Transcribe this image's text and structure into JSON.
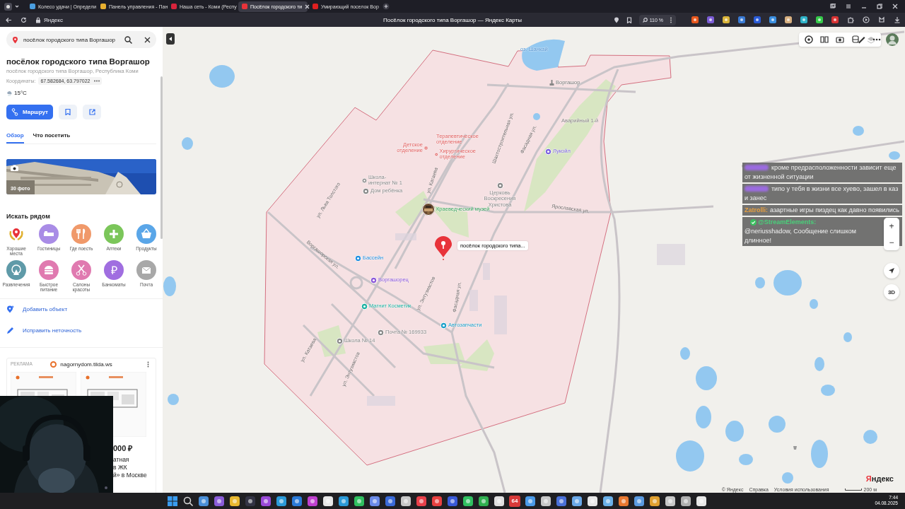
{
  "browser": {
    "tabs": [
      {
        "title": "Колесо удачи | Определи",
        "selected": false,
        "color": "#4a9ee0"
      },
      {
        "title": "Панель управления - Пан",
        "selected": false,
        "color": "#e8b030"
      },
      {
        "title": "Наша сеть - Коми (Респу",
        "selected": false,
        "color": "#d8243c"
      },
      {
        "title": "Посёлок городского ти",
        "selected": true,
        "color": "#e8333a"
      },
      {
        "title": "Умирающий поселок Вор",
        "selected": false,
        "color": "#e02020"
      }
    ],
    "address": "Яндекс",
    "page_title": "Посёлок городского типа Воргашор — Яндекс Карты",
    "zoom": "110 %",
    "extensions": [
      {
        "color": "#e8581e"
      },
      {
        "color": "#7b5cd6"
      },
      {
        "color": "#d9b43a"
      },
      {
        "color": "#3a7bd5"
      },
      {
        "color": "#2a5bd7"
      },
      {
        "color": "#3b8fe0"
      },
      {
        "color": "#d8b080"
      },
      {
        "color": "#2fb3c9"
      },
      {
        "color": "#35c94a"
      },
      {
        "color": "#d93434"
      }
    ]
  },
  "search": {
    "value": "посёлок городского типа Воргашор"
  },
  "place": {
    "title": "посёлок городского типа Воргашор",
    "subtitle": "посёлок городского типа Воргашор, Республика Коми",
    "coords_label": "Координаты:",
    "coords": "67.582684, 63.797022",
    "weather": "15°C"
  },
  "route_button": "Маршрут",
  "tabs": [
    {
      "label": "Обзор",
      "selected": true
    },
    {
      "label": "Что посетить",
      "selected": false
    }
  ],
  "photos": {
    "count": "30 фото"
  },
  "nearby": {
    "title": "Искать рядом",
    "categories": [
      {
        "label": "Хорошие места",
        "kind": "laurel",
        "color": "#e8333a"
      },
      {
        "label": "Гостиницы",
        "kind": "bed",
        "color": "#a98ce6"
      },
      {
        "label": "Где поесть",
        "kind": "fork",
        "color": "#f0996a"
      },
      {
        "label": "Аптеки",
        "kind": "plus",
        "color": "#7bc65a"
      },
      {
        "label": "Продукты",
        "kind": "basket",
        "color": "#5aa6e8"
      },
      {
        "label": "Развлечения",
        "kind": "wheel",
        "color": "#5f9aa8"
      },
      {
        "label": "Быстрое питание",
        "kind": "burger",
        "color": "#e07ab0"
      },
      {
        "label": "Салоны красоты",
        "kind": "scissors",
        "color": "#e07ab0"
      },
      {
        "label": "Банкоматы",
        "kind": "symbol",
        "symbol": "₽",
        "color": "#a06ee0"
      },
      {
        "label": "Почта",
        "kind": "mail",
        "color": "#a8a8a8"
      }
    ]
  },
  "links": [
    {
      "label": "Добавить объект",
      "kind": "add"
    },
    {
      "label": "Исправить неточность",
      "kind": "edit"
    }
  ],
  "ad": {
    "badge": "РЕКЛАМА",
    "domain": "nagornydom.tilda.ws",
    "price": "000 ₽",
    "lines": [
      "атная",
      "в ЖК",
      "й» в Москве"
    ]
  },
  "map": {
    "labels": [
      {
        "text": "оз. Шанкай",
        "kind": "water"
      },
      {
        "text": "Воргашор",
        "kind": "place"
      },
      {
        "text": "Аварийный 1-й",
        "kind": "street"
      },
      {
        "text": "Терапевтическое отделение",
        "kind": "medical"
      },
      {
        "text": "Детское отделение",
        "kind": "medical"
      },
      {
        "text": "Хирургическое отделение",
        "kind": "medical"
      },
      {
        "text": "Лукойл",
        "kind": "fuel"
      },
      {
        "text": "Школа-интернат № 1",
        "kind": "poi"
      },
      {
        "text": "Дом ребёнка",
        "kind": "poi"
      },
      {
        "text": "Церковь Воскресения Христова",
        "kind": "poi"
      },
      {
        "text": "Краеведческий музей",
        "kind": "museum"
      },
      {
        "text": "Бассейн",
        "kind": "sport"
      },
      {
        "text": "Воргашорец",
        "kind": "culture"
      },
      {
        "text": "Магнит Косметик",
        "kind": "shop"
      },
      {
        "text": "Автозапчасти",
        "kind": "auto"
      },
      {
        "text": "Почта № 169933",
        "kind": "poi"
      },
      {
        "text": "Школа № 14",
        "kind": "poi"
      }
    ],
    "streets": [
      "ул. Льва Толстого",
      "ул. Катаева",
      "Шахтостроительная ул.",
      "Фасадная ул.",
      "Ярославская ул.",
      "Воргашорская ул.",
      "ул. Энтузиастов",
      "Фасадная ул.",
      "ул. Катаева",
      "ул. Энтузиастов"
    ],
    "pin_label": "посёлок городского типа...",
    "zoom_in": "+",
    "zoom_out": "−",
    "view_3d": "3D",
    "logo": "Яндекс",
    "footer": [
      "© Яндекс",
      "Справка",
      "Условия использования"
    ],
    "scale": "200 м"
  },
  "chat": {
    "messages": [
      {
        "color": "#9b6be0",
        "text": "кроме предрасположенности зависит еще от жизненной ситуации"
      },
      {
        "color": "#9b6be0",
        "text": "типо у тебя в жизни все хуево, зашел в каз и занес"
      },
      {
        "author": "Zatrolli:",
        "color": "#e8a040",
        "text": "азартные игры пиздец как давно появились"
      },
      {
        "author": "@StreamElements:",
        "color": "#4ad07a",
        "badge": true,
        "text": "@neriusshadow, Сообщение слишком длинное!"
      }
    ]
  },
  "taskbar": {
    "apps": [
      {
        "kind": "start",
        "color": "#3a9cf0"
      },
      {
        "kind": "search",
        "color": "#dddddd"
      },
      {
        "kind": "app",
        "color": "#4a8fd8"
      },
      {
        "kind": "app",
        "color": "#8a5cd8"
      },
      {
        "kind": "app",
        "color": "#e8b830"
      },
      {
        "kind": "app",
        "color": "#333344"
      },
      {
        "kind": "app",
        "color": "#9a4ad8"
      },
      {
        "kind": "app",
        "color": "#2a9ad8"
      },
      {
        "kind": "app",
        "color": "#2a7ad8"
      },
      {
        "kind": "app",
        "color": "#c040d0"
      },
      {
        "kind": "app",
        "color": "#e8e8e8"
      },
      {
        "kind": "app",
        "color": "#2a9ad8"
      },
      {
        "kind": "app",
        "color": "#30c060"
      },
      {
        "kind": "app",
        "color": "#6a8ae8"
      },
      {
        "kind": "app",
        "color": "#3a6ad8"
      },
      {
        "kind": "app",
        "color": "#c8c8c8"
      },
      {
        "kind": "app",
        "color": "#e8404a"
      },
      {
        "kind": "app",
        "color": "#e84040"
      },
      {
        "kind": "app",
        "color": "#3a5ad8"
      },
      {
        "kind": "app",
        "color": "#30c060"
      },
      {
        "kind": "app",
        "color": "#30b050"
      },
      {
        "kind": "app",
        "color": "#e0e0e0"
      },
      {
        "kind": "app",
        "text": "64",
        "color": "#d83a3a"
      },
      {
        "kind": "app",
        "color": "#4a9ae8"
      },
      {
        "kind": "app",
        "color": "#c8c8c8"
      },
      {
        "kind": "app",
        "color": "#4a70d8"
      },
      {
        "kind": "app",
        "color": "#6aa8e8"
      },
      {
        "kind": "app",
        "color": "#e8e8e8"
      },
      {
        "kind": "app",
        "color": "#6ab0e8"
      },
      {
        "kind": "app",
        "color": "#e87830"
      },
      {
        "kind": "app",
        "color": "#5a9ae0"
      },
      {
        "kind": "app",
        "color": "#e0a030"
      },
      {
        "kind": "app",
        "color": "#c8c8c8"
      },
      {
        "kind": "app",
        "color": "#b0b0b0"
      },
      {
        "kind": "app",
        "color": "#e8e8e8"
      }
    ],
    "time": "7:44",
    "date": "04.08.2025"
  }
}
